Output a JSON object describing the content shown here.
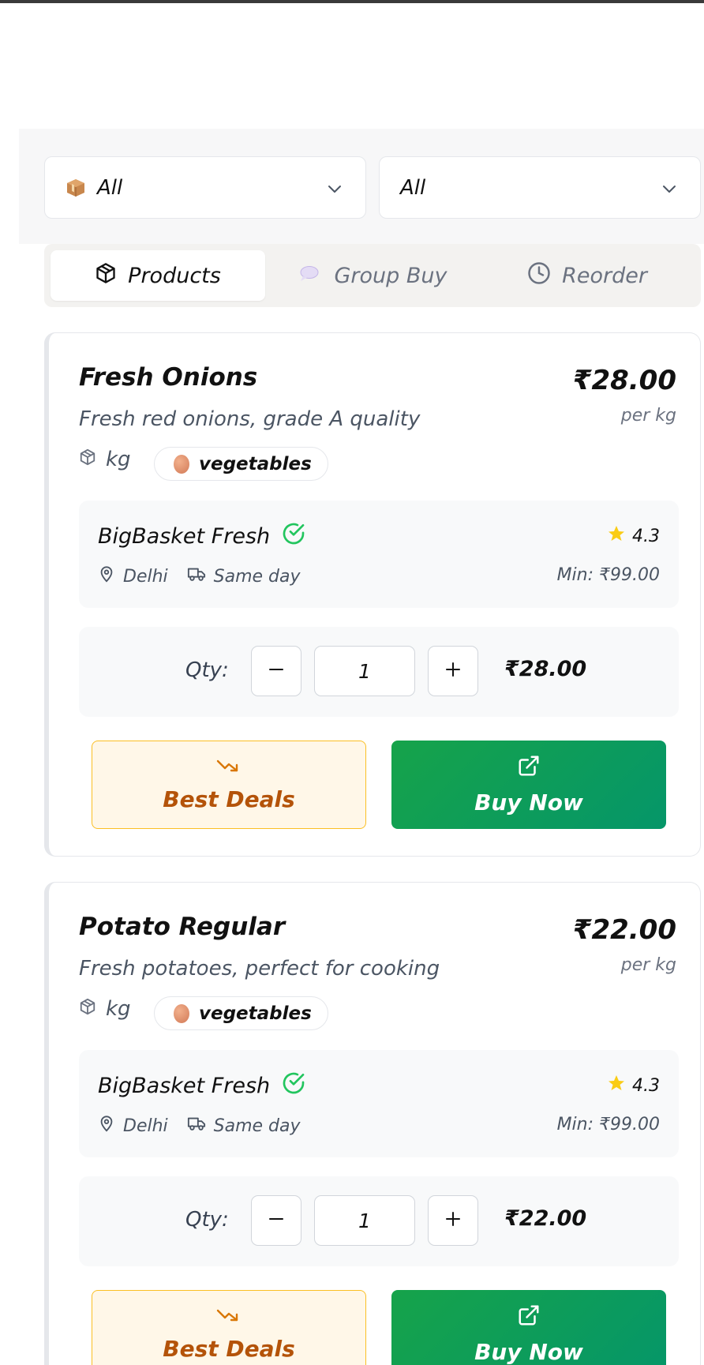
{
  "filters": {
    "category_value": "All",
    "category_icon": "package-emoji",
    "second_value": "All"
  },
  "tabs": [
    {
      "label": "Products",
      "icon": "package-icon",
      "active": true
    },
    {
      "label": "Group Buy",
      "icon": "speech-bubble-emoji",
      "active": false
    },
    {
      "label": "Reorder",
      "icon": "clock-icon",
      "active": false
    }
  ],
  "products": [
    {
      "name": "Fresh Onions",
      "price": "₹28.00",
      "unit_note": "per kg",
      "description": "Fresh red onions, grade A quality",
      "unit": "kg",
      "category": "vegetables",
      "vendor": {
        "name": "BigBasket Fresh",
        "rating": "4.3",
        "location": "Delhi",
        "delivery": "Same day",
        "min_order": "Min: ₹99.00"
      },
      "qty_label": "Qty:",
      "qty": "1",
      "total": "₹28.00",
      "deals_label": "Best Deals",
      "buy_label": "Buy Now"
    },
    {
      "name": "Potato Regular",
      "price": "₹22.00",
      "unit_note": "per kg",
      "description": "Fresh potatoes, perfect for cooking",
      "unit": "kg",
      "category": "vegetables",
      "vendor": {
        "name": "BigBasket Fresh",
        "rating": "4.3",
        "location": "Delhi",
        "delivery": "Same day",
        "min_order": "Min: ₹99.00"
      },
      "qty_label": "Qty:",
      "qty": "1",
      "total": "₹22.00",
      "deals_label": "Best Deals",
      "buy_label": "Buy Now"
    }
  ],
  "colors": {
    "buy": "#16a34a",
    "deals_text": "#b45309",
    "deals_border": "#fbbf24",
    "verified": "#22c55e",
    "star": "#facc15"
  }
}
